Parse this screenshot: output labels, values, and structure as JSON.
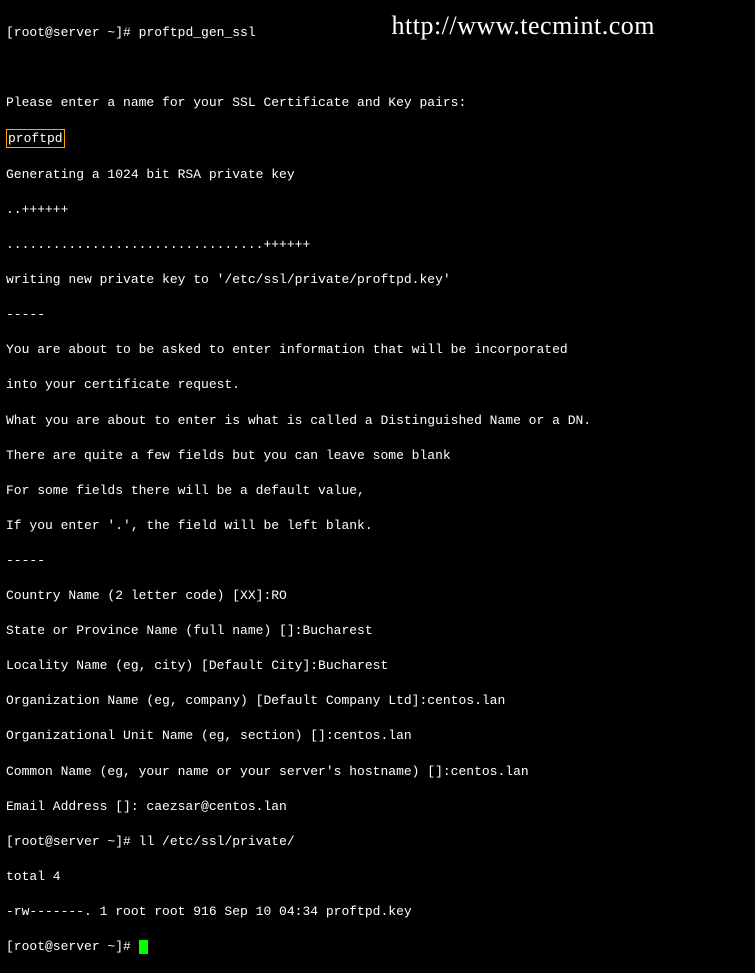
{
  "watermark": "http://www.tecmint.com",
  "prompt1": {
    "user_host": "[root@server ~]#",
    "command": "proftpd_gen_ssl"
  },
  "ssl_prompt": "Please enter a name for your SSL Certificate and Key pairs:",
  "ssl_name": "proftpd",
  "gen_key": "Generating a 1024 bit RSA private key",
  "progress1": "..++++++",
  "progress2": ".................................++++++",
  "writing_key": "writing new private key to '/etc/ssl/private/proftpd.key'",
  "dashes": "-----",
  "info1": "You are about to be asked to enter information that will be incorporated",
  "info2": "into your certificate request.",
  "info3": "What you are about to enter is what is called a Distinguished Name or a DN.",
  "info4": "There are quite a few fields but you can leave some blank",
  "info5": "For some fields there will be a default value,",
  "info6": "If you enter '.', the field will be left blank.",
  "country": "Country Name (2 letter code) [XX]:RO",
  "state": "State or Province Name (full name) []:Bucharest",
  "locality": "Locality Name (eg, city) [Default City]:Bucharest",
  "org": "Organization Name (eg, company) [Default Company Ltd]:centos.lan",
  "orgunit": "Organizational Unit Name (eg, section) []:centos.lan",
  "common_name": "Common Name (eg, your name or your server's hostname) []:centos.lan",
  "email": "Email Address []: caezsar@centos.lan",
  "prompt2": {
    "user_host": "[root@server ~]#",
    "command": "ll /etc/ssl/private/"
  },
  "total": "total 4",
  "filelisting": "-rw-------. 1 root root 916 Sep 10 04:34 proftpd.key",
  "prompt3": {
    "user_host": "[root@server ~]#"
  }
}
